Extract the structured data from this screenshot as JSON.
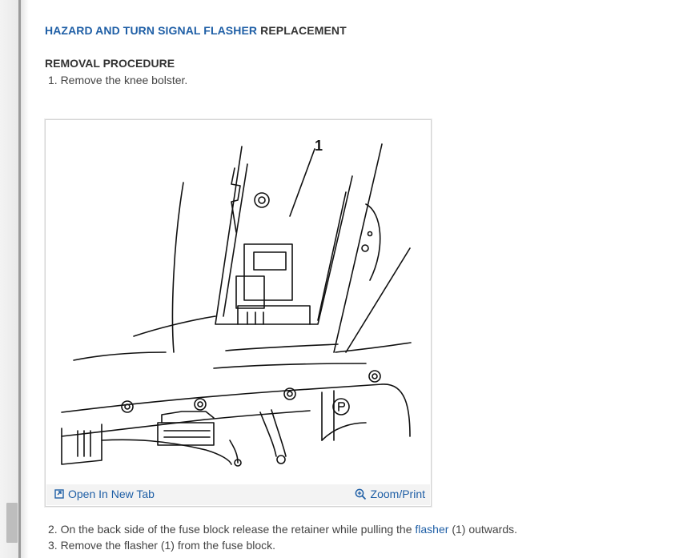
{
  "title": {
    "link": "HAZARD AND TURN SIGNAL FLASHER",
    "rest": "REPLACEMENT"
  },
  "section": {
    "heading": "REMOVAL PROCEDURE"
  },
  "steps": {
    "s1": "1. Remove the knee bolster.",
    "s2_prefix": "2. On the back side of the fuse block release the retainer while pulling the",
    "s2_link": "flasher",
    "s2_suffix": "(1) outwards.",
    "s3": "3. Remove the flasher (1) from the fuse block."
  },
  "figure": {
    "callout": "1",
    "open_tab_label": "Open In New Tab",
    "zoom_label": "Zoom/Print",
    "open_tab_icon": "open-in-new-tab-icon",
    "zoom_icon": "zoom-in-icon"
  },
  "colors": {
    "link": "#1f5fa6",
    "text": "#333333",
    "bar": "#f3f3f3"
  }
}
